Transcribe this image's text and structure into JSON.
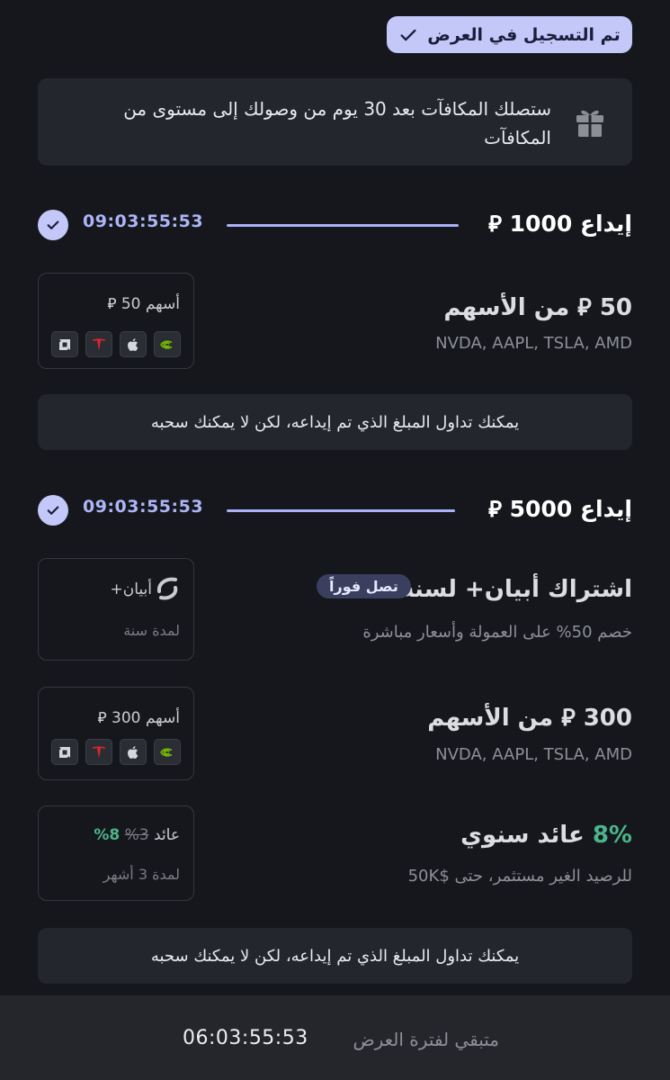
{
  "registration": {
    "badge_label": "تم التسجيل في العرض"
  },
  "info": {
    "text": "ستصلك المكافآت بعد 30 يوم من وصولك إلى مستوى من المكافآت"
  },
  "tiers": [
    {
      "title": "إيداع 1000 ⃁",
      "timer": "09:03:55:53",
      "rewards": [
        {
          "title": "50 ⃁ من الأسهم",
          "subtitle": "NVDA, AAPL, TSLA, AMD",
          "card_label": "أسهم 50 ⃁",
          "logos": [
            "nvidia-logo",
            "apple-logo",
            "tesla-logo",
            "amd-logo"
          ]
        }
      ],
      "note": "يمكنك تداول المبلغ الذي تم إيداعه، لكن لا يمكنك سحبه"
    },
    {
      "title": "إيداع 5000 ⃁",
      "timer": "09:03:55:53",
      "rewards": [
        {
          "title": "اشتراك أبيان+ لسنة",
          "pill": "تصل فوراً",
          "subtitle": "خصم 50% على العمولة وأسعار مباشرة",
          "card_label": "أبيان+",
          "card_sub": "لمدة سنة"
        },
        {
          "title": "300 ⃁ من الأسهم",
          "subtitle": "NVDA, AAPL, TSLA, AMD",
          "card_label": "أسهم 300 ⃁",
          "logos": [
            "nvidia-logo",
            "apple-logo",
            "tesla-logo",
            "amd-logo"
          ]
        },
        {
          "title_value": "8%",
          "title_text": "عائد سنوي",
          "subtitle": "للرصيد الغير مستثمر، حتى $50K",
          "card_label": "عائد",
          "card_old": "3%",
          "card_new": "8%",
          "card_sub": "لمدة 3 أشهر"
        }
      ],
      "note": "يمكنك تداول المبلغ الذي تم إيداعه، لكن لا يمكنك سحبه"
    }
  ],
  "footer": {
    "remaining_label": "متبقي لفترة العرض",
    "remaining_timer": "06:03:55:53"
  },
  "colors": {
    "accent": "#c3c8f9",
    "green": "#4bb48a",
    "background": "#15171c",
    "card": "#23262c"
  }
}
